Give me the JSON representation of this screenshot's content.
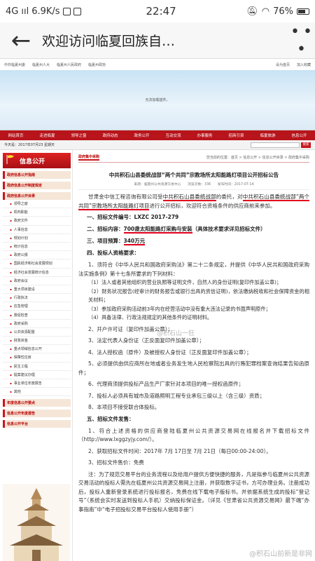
{
  "status": {
    "network": "4G",
    "signal": "ııl",
    "speed": "6.9K/s",
    "time": "22:47",
    "battery": "76%"
  },
  "appbar": {
    "title": "欢迎访问临夏回族自…",
    "more": "• • •"
  },
  "top_links": {
    "items": [
      "中共临夏州委",
      "临夏州人大",
      "临夏州人民政府",
      "临夏州政协"
    ],
    "right": [
      "设为首页",
      "加入收藏"
    ]
  },
  "banner": {
    "message": "无法加载插件。"
  },
  "nav": {
    "items": [
      "网站首页",
      "走进临夏",
      "领导之窗",
      "政府动态",
      "政务公开",
      "互动交流",
      "办事服务",
      "招商引资",
      "临夏旅游",
      "信息公开"
    ]
  },
  "datebar": {
    "date": "今天是：2017年07月23 星期天",
    "search_btn": "搜索"
  },
  "sidebar": {
    "title": "信息公开",
    "headers": [
      "政府信息公开指南",
      "政府信息公开制度规定",
      "政府信息公开目录"
    ],
    "items": [
      "领导之窗",
      "机构职能",
      "政府文件",
      "人事信息",
      "规划计划",
      "统计信息",
      "政府公报",
      "国民经济和社会发展规划",
      "经济社会发展统计信息",
      "政府会议",
      "重大项目建设",
      "行政执法",
      "应急管理",
      "督促检查",
      "政府采购",
      "公共资源配置",
      "财政资金",
      "重点领域信息公开",
      "保障性住房",
      "民生工程",
      "提案建议办理",
      "事业单位年度报告",
      "其他"
    ],
    "footer_headers": [
      "年度信息公开要点",
      "信息公开年度报告",
      "信息公开平台"
    ]
  },
  "content": {
    "tab": "政府集中采购",
    "crumb": "您当前的位置：首页 > 信息公开 > 信息公开目录 > 政府集中采购",
    "title": "中共积石山县委统战部“两个共同”宗教场所太阳能路灯项目公开招标公告",
    "meta": "来源：临夏州公共资源交易中心　　浏览次数：336　　发布时间：2017-07-14",
    "intro_a": "甘肃金中信工程咨询有限公司受",
    "intro_b": "中共积石山县委统战部",
    "intro_c": "的委托，对",
    "intro_d": "中共积石山县委统战部“两个共同”宗教场所太阳能路灯项目",
    "intro_e": "进行公开招标，欢迎符合资格条件的供应商前来参加。",
    "s1": "一、招标文件编号：LXZC 2017-279",
    "s2_label": "二、招标内容：",
    "s2_val": "700盏太阳能路灯采购与安装",
    "s2_rest": "（具体技术要求详见招标文件）",
    "s3_label": "三、项目预算：",
    "s3_val": "340万元",
    "s4": "四、投标人资格要求：",
    "p1": "1、须符合《中华人民共和国政府采购法》第二十二条规定，并提供《中华人民共和国政府采购法实施条例》第十七条所要求的下列材料：",
    "p1a": "（1）法人或者其他组织的营业执照等证明文件，自然人的身份证明(复印件加盖公章)；",
    "p1b": "（2）财务状况报告(经审计的财务报告或银行出具的资信证明)，依法缴纳税收和社会保障资金的相关材料；",
    "p1c": "（3）参加政府采购活动前3年内在经营活动中没有重大违法记录的书面声明原件；",
    "p1d": "（4）具备法律、行政法规规定的其他条件的证明材料。",
    "p2": "2、开户许可证（复印件加盖公章）；",
    "p3": "3、法定代表人身份证（正反面复印件加盖公章）；",
    "p4": "4、法人授权函（原件）及被授权人身份证（正反面复印件加盖公章）；",
    "p5": "5、必须提供由供应商所在地或者业务发生地人民检察院出具的行贿犯罪档案查询结果告知函原件；",
    "p6": "6、代理商须提供投标产品生产厂家针对本项目的唯一授权函原件；",
    "p7": "7、投标人必须具有城市及道路照明工程专业承包三级以上（含三级）资质；",
    "p8": "8、本项目不接受联合体投标。",
    "s5": "五、招标文件发售：",
    "q1": "1、符合上述资格的供应商登陆临夏州公共资源交易网在线报名并下载招标文件（http://www.lxggzyjy.com/）。",
    "q2": "2、获取招标文件时间：2017年 7月 17日至 7月 21日（每日00:00-24:00）。",
    "q3": "3、招标文件售价：免费",
    "note": "注：为了规范交易平台的业务流程以及给用户提供方便快捷的服务，凡是拟参与临夏州公共资源交易活动的投标人需先在临夏州公共资源交易网上注册，并获取数字证书，方可办理业务。注册成功后，投标人重新登录系统进行投标报名，免费在线下载电子版标书。并依据系统生成的投标“登记号”（系统会实时发送到投标人手机）交纳投标保证金。（详见《甘肃省公共资源交易网》最下端“办事指南”中“电子招投标交易平台投标人使用手册”）"
  },
  "watermarks": {
    "center": "@积石山一狂",
    "corner": "@积石山前新是非网"
  }
}
